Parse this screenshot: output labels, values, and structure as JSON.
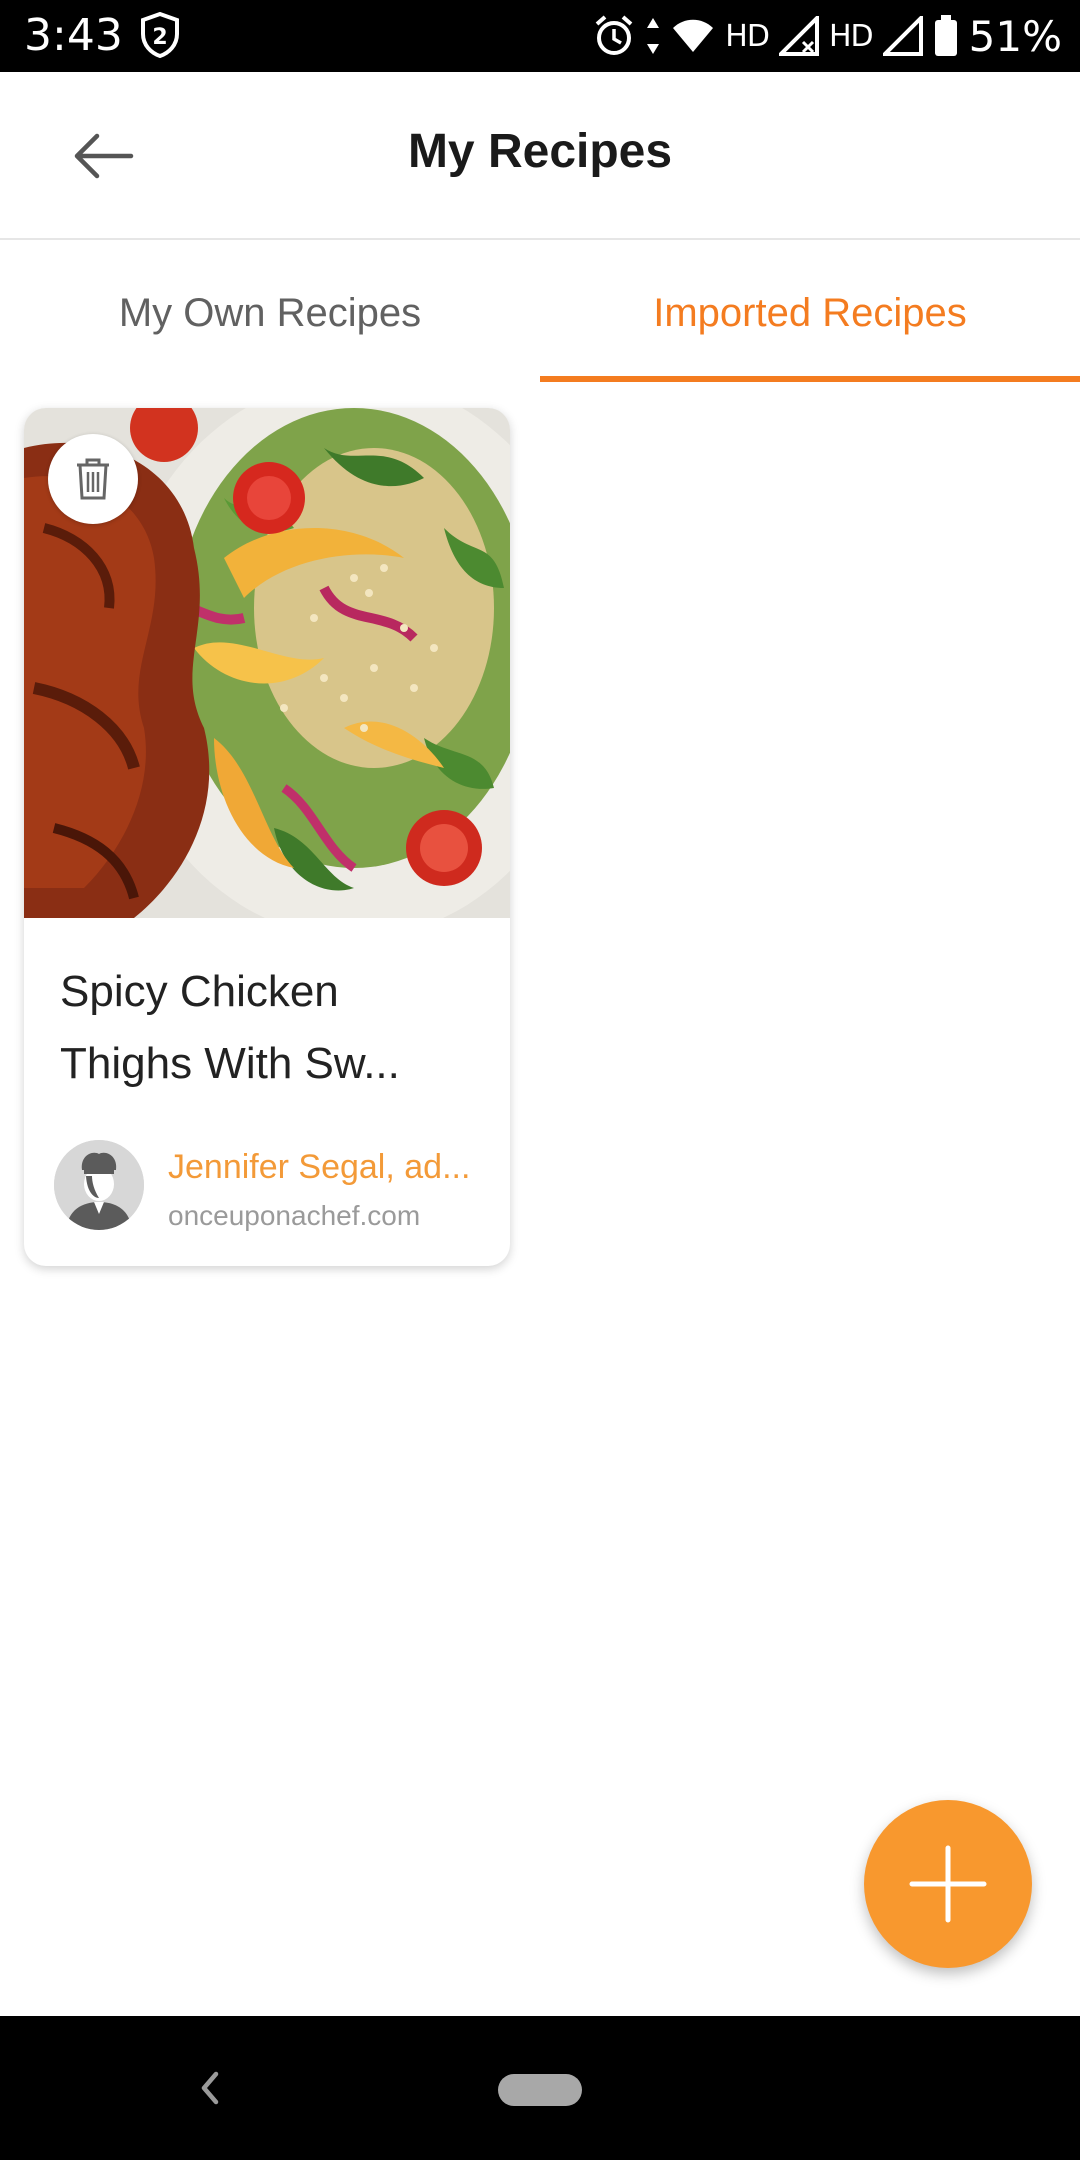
{
  "status_bar": {
    "time": "3:43",
    "shield_badge": "2",
    "network_label_1": "HD",
    "network_label_2": "HD",
    "battery": "51%"
  },
  "app_bar": {
    "title": "My Recipes",
    "back_icon": "arrow-left-icon"
  },
  "tabs": [
    {
      "label": "My Own Recipes",
      "selected": false
    },
    {
      "label": "Imported Recipes",
      "selected": true
    }
  ],
  "recipes": [
    {
      "title_line1": "Spicy Chicken",
      "title_line2": "Thighs With Sw...",
      "author": "Jennifer Segal, ad...",
      "source": "onceuponachef.com",
      "delete_icon": "trash-icon"
    }
  ],
  "fab": {
    "icon": "plus-icon"
  },
  "colors": {
    "accent": "#f47c20",
    "fab": "#f8982e",
    "author": "#f39a38"
  }
}
